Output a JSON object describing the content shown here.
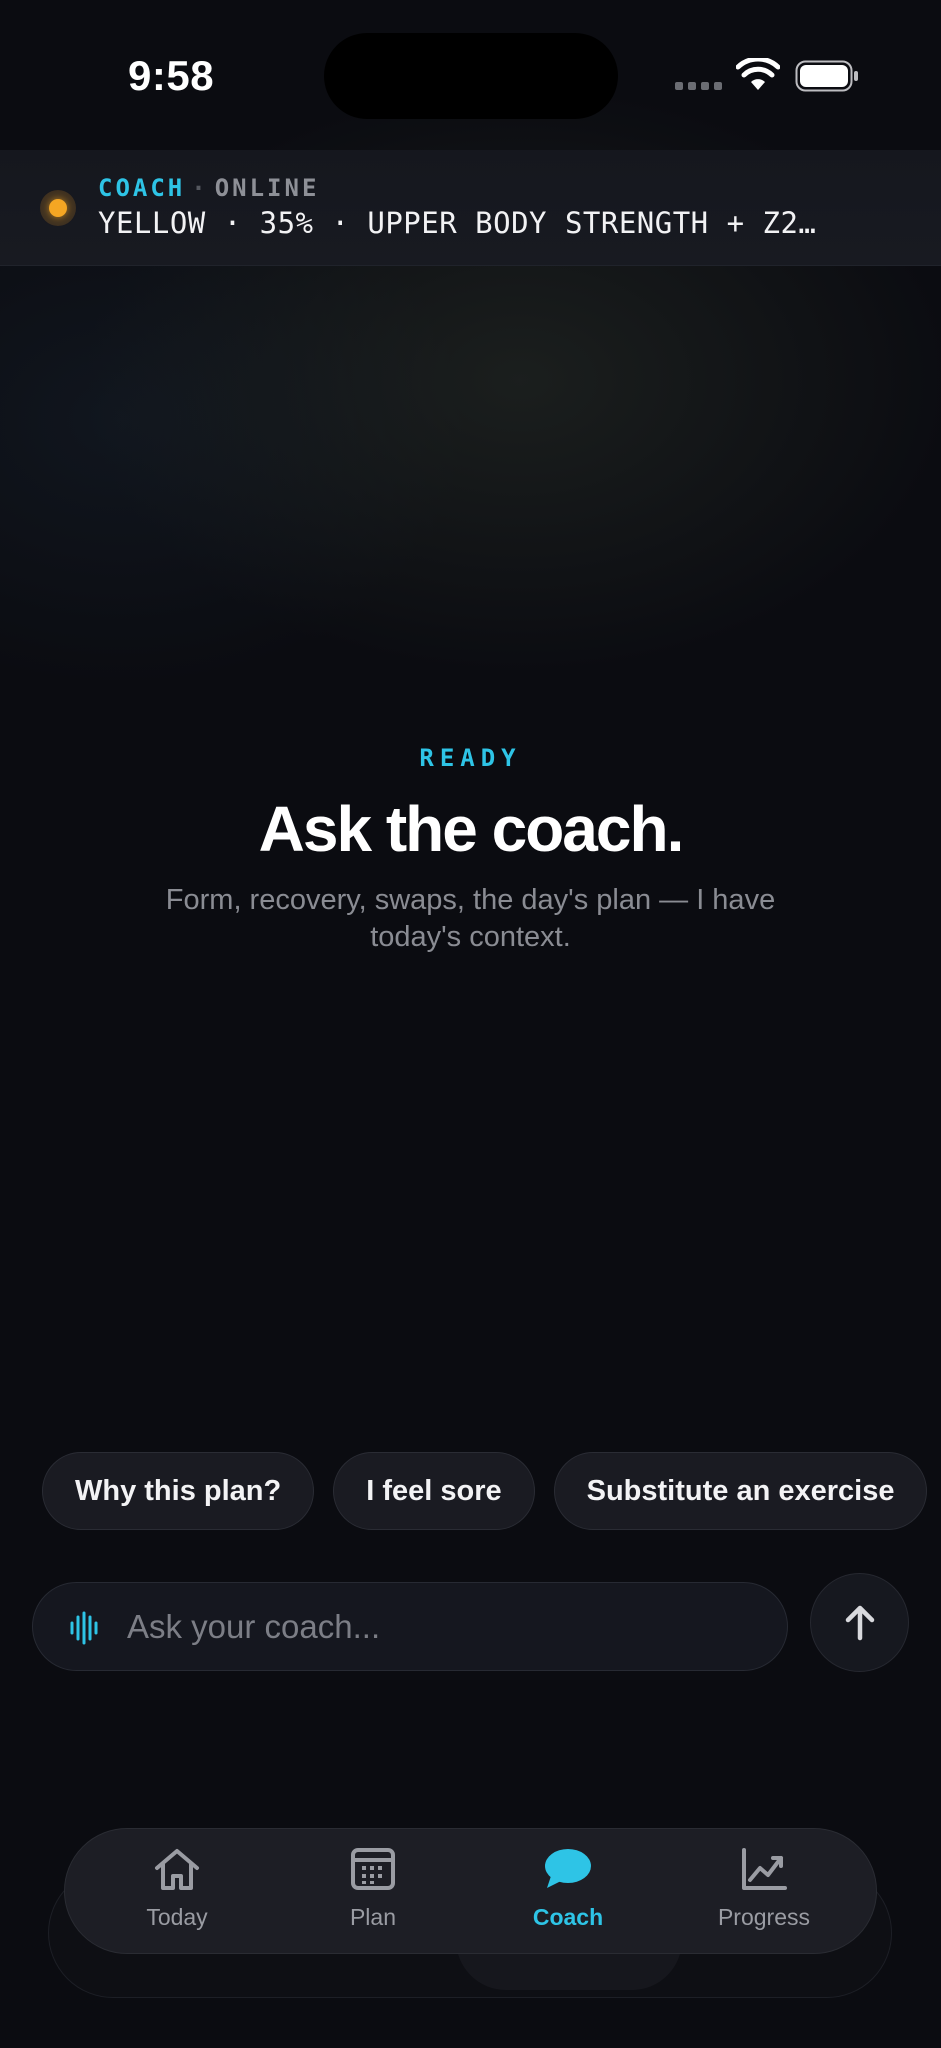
{
  "status_bar": {
    "time": "9:58",
    "icons": [
      "cellular-signal-icon",
      "wifi-icon",
      "battery-icon"
    ]
  },
  "header": {
    "coach_label": "COACH",
    "separator": "·",
    "online_label": "ONLINE",
    "context_line": "YELLOW · 35%  ·  UPPER BODY STRENGTH + Z2…",
    "status_color": "#f5a623"
  },
  "empty_state": {
    "ready_label": "READY",
    "title": "Ask the coach.",
    "subtitle": "Form, recovery, swaps, the day's plan — I have today's context."
  },
  "suggestions": [
    {
      "label": "Why this plan?"
    },
    {
      "label": "I feel sore"
    },
    {
      "label": "Substitute an exercise"
    }
  ],
  "composer": {
    "placeholder": "Ask your coach...",
    "value": ""
  },
  "tabs": [
    {
      "label": "Today",
      "icon": "house-icon",
      "active": false
    },
    {
      "label": "Plan",
      "icon": "calendar-icon",
      "active": false
    },
    {
      "label": "Coach",
      "icon": "chat-bubble-icon",
      "active": true
    },
    {
      "label": "Progress",
      "icon": "chart-up-icon",
      "active": false
    }
  ],
  "colors": {
    "accent": "#2ec4e6",
    "background": "#0b0c11",
    "warning": "#f5a623"
  }
}
